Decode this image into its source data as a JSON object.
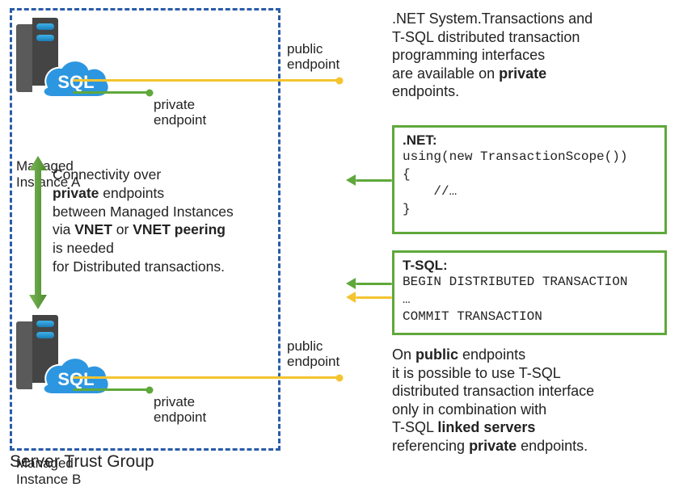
{
  "trust_group": {
    "label": "Server Trust Group"
  },
  "instances": {
    "a": {
      "label_line1": "Managed",
      "label_line2": "Instance A",
      "icon_text": "SQL"
    },
    "b": {
      "label_line1": "Managed",
      "label_line2": "Instance B",
      "icon_text": "SQL"
    }
  },
  "endpoints": {
    "public": "public",
    "endpoint": "endpoint",
    "private": "private"
  },
  "connectivity": {
    "l1": "Connectivity over",
    "l2a": "private",
    "l2b": " endpoints",
    "l3": "between Managed Instances",
    "l4a": "via ",
    "l4b": "VNET",
    "l4c": " or ",
    "l4d": "VNET peering",
    "l5": "is needed",
    "l6": "for Distributed transactions."
  },
  "top_desc": {
    "l1": ".NET System.Transactions and",
    "l2": "T-SQL distributed transaction",
    "l3": "programming interfaces",
    "l4a": "are available on ",
    "l4b": "private",
    "l5": "endpoints."
  },
  "code_net": {
    "title": ".NET:",
    "line1": "using(new TransactionScope())",
    "line2": "{",
    "line3": "    //…",
    "line4": "}"
  },
  "code_tsql": {
    "title": "T-SQL:",
    "line1": "BEGIN DISTRIBUTED TRANSACTION",
    "line2": "…",
    "line3": "COMMIT TRANSACTION"
  },
  "bottom_desc": {
    "l1a": "On ",
    "l1b": "public",
    "l1c": " endpoints",
    "l2": "it is possible to use T-SQL",
    "l3": "distributed transaction interface",
    "l4": "only in combination with",
    "l5a": "T-SQL ",
    "l5b": "linked servers",
    "l6a": "referencing ",
    "l6b": "private",
    "l6c": " endpoints."
  },
  "colors": {
    "dash_blue": "#2a5ca8",
    "green": "#5fa83b",
    "yellow": "#f4c430",
    "cloud_blue": "#2d96e0"
  }
}
